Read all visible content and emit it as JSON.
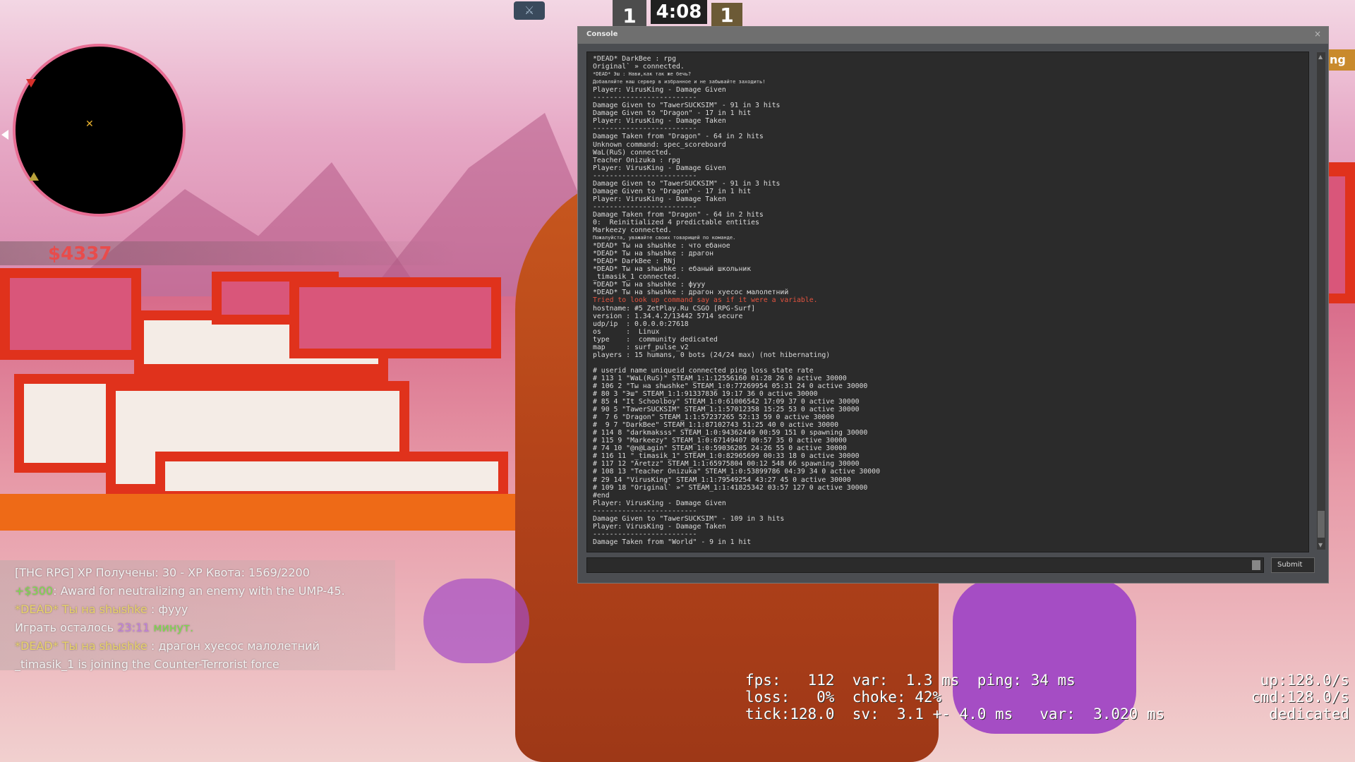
{
  "hud": {
    "money": "$4337",
    "timer": "4:08",
    "score_ct": "1",
    "score_t": "1",
    "right_edge_text": "ng",
    "radar": {
      "map_marker": "✕"
    }
  },
  "chat": [
    {
      "text": "[THC RPG] XP Получены: 30 - XP Квота: 1569/2200",
      "color": "#f2f2f2"
    },
    {
      "parts": [
        {
          "text": "+$300",
          "color": "#7cdc4c"
        },
        {
          "text": ": Award for neutralizing an enemy with the UMP-45.",
          "color": "#f2f2f2"
        }
      ]
    },
    {
      "parts": [
        {
          "text": "*DEAD* Ты на shыshke",
          "color": "#e8d36a"
        },
        {
          "text": " : фууу",
          "color": "#f2f2f2"
        }
      ]
    },
    {
      "parts": [
        {
          "text": "Играть осталось ",
          "color": "#f2f2f2"
        },
        {
          "text": "23:11",
          "color": "#c080e0"
        },
        {
          "text": " минут.",
          "color": "#7cdc4c"
        }
      ]
    },
    {
      "parts": [
        {
          "text": "*DEAD* Ты на shыshke",
          "color": "#e8d36a"
        },
        {
          "text": " : драгон хуесос малолетний",
          "color": "#f2f2f2"
        }
      ]
    },
    {
      "text": "_timasik_1 is joining the Counter-Terrorist force",
      "color": "#f2f2f2"
    }
  ],
  "netgraph": {
    "fps_line": "fps:   112  var:  1.3 ms  ping: 34 ms",
    "loss_line": "loss:   0%  choke: 42%",
    "tick_line": "tick:128.0  sv:  3.1 +- 4.0 ms   var:  3.020 ms",
    "up": "up:128.0/s",
    "cmd": "cmd:128.0/s",
    "server_type": "dedicated"
  },
  "console": {
    "title": "Console",
    "close": "×",
    "submit_label": "Submit",
    "lines": [
      {
        "t": "*DEAD* DarkBee : rpg"
      },
      {
        "t": "Original` » connected."
      },
      {
        "t": "*DEAD* Эш : Нави,как так же бечь?",
        "s": true
      },
      {
        "t": "Добавляйте наш сервер в избранное и не забывайте заходить!",
        "s": true
      },
      {
        "t": "Player: VirusKing - Damage Given"
      },
      {
        "t": "-------------------------"
      },
      {
        "t": "Damage Given to \"TawerSUCKSIM\" - 91 in 3 hits"
      },
      {
        "t": "Damage Given to \"Dragon\" - 17 in 1 hit"
      },
      {
        "t": "Player: VirusKing - Damage Taken"
      },
      {
        "t": "-------------------------"
      },
      {
        "t": "Damage Taken from \"Dragon\" - 64 in 2 hits"
      },
      {
        "t": "Unknown command: spec_scoreboard"
      },
      {
        "t": "WaL(RuS) connected."
      },
      {
        "t": "Teacher Onizuka : rpg"
      },
      {
        "t": "Player: VirusKing - Damage Given"
      },
      {
        "t": "-------------------------"
      },
      {
        "t": "Damage Given to \"TawerSUCKSIM\" - 91 in 3 hits"
      },
      {
        "t": "Damage Given to \"Dragon\" - 17 in 1 hit"
      },
      {
        "t": "Player: VirusKing - Damage Taken"
      },
      {
        "t": "-------------------------"
      },
      {
        "t": "Damage Taken from \"Dragon\" - 64 in 2 hits"
      },
      {
        "t": "0:  Reinitialized 4 predictable entities"
      },
      {
        "t": "Markeezy connected."
      },
      {
        "t": "Пожалуйста, уважайте своих товарищей по команде.",
        "s": true
      },
      {
        "t": "*DEAD* Ты на shыshke : что ебаное"
      },
      {
        "t": "*DEAD* Ты на shыshke : драгон"
      },
      {
        "t": "*DEAD* DarkBee : RNj"
      },
      {
        "t": "*DEAD* Ты на shыshke : ебаный школьник"
      },
      {
        "t": "_timasik_1 connected."
      },
      {
        "t": "*DEAD* Ты на shыshke : фууу"
      },
      {
        "t": "*DEAD* Ты на shыshke : драгон хуесос малолетний"
      },
      {
        "t": "Tried to look up command say as if it were a variable.",
        "err": true
      },
      {
        "t": "hostname: #5 ZetPlay.Ru CSGO [RPG-Surf]"
      },
      {
        "t": "version : 1.34.4.2/13442 5714 secure"
      },
      {
        "t": "udp/ip  : 0.0.0.0:27618"
      },
      {
        "t": "os      :  Linux"
      },
      {
        "t": "type    :  community dedicated"
      },
      {
        "t": "map     : surf_pulse_v2"
      },
      {
        "t": "players : 15 humans, 0 bots (24/24 max) (not hibernating)"
      },
      {
        "t": ""
      },
      {
        "t": "# userid name uniqueid connected ping loss state rate"
      },
      {
        "t": "# 113 1 \"WaL(RuS)\" STEAM_1:1:12556160 01:28 26 0 active 30000"
      },
      {
        "t": "# 106 2 \"Ты на shыshke\" STEAM_1:0:77269954 05:31 24 0 active 30000"
      },
      {
        "t": "# 80 3 \"Эш\" STEAM_1:1:91337836 19:17 36 0 active 30000"
      },
      {
        "t": "# 85 4 \"It Schoolboy\" STEAM_1:0:61006542 17:09 37 0 active 30000"
      },
      {
        "t": "# 90 5 \"TawerSUCKSIM\" STEAM_1:1:57012358 15:25 53 0 active 30000"
      },
      {
        "t": "#  7 6 \"Dragon\" STEAM_1:1:57237265 52:13 59 0 active 30000"
      },
      {
        "t": "#  9 7 \"DarkBee\" STEAM_1:1:87102743 51:25 40 0 active 30000"
      },
      {
        "t": "# 114 8 \"darkmaksss\" STEAM_1:0:94362449 00:59 151 0 spawning 30000"
      },
      {
        "t": "# 115 9 \"Markeezy\" STEAM_1:0:67149407 00:57 35 0 active 30000"
      },
      {
        "t": "# 74 10 \"@n@Lagin\" STEAM_1:0:59036205 24:26 55 0 active 30000"
      },
      {
        "t": "# 116 11 \"_timasik_1\" STEAM_1:0:82965699 00:33 18 0 active 30000"
      },
      {
        "t": "# 117 12 \"Aretzz\" STEAM_1:1:65975804 00:12 548 66 spawning 30000"
      },
      {
        "t": "# 108 13 \"Teacher Onizuka\" STEAM_1:0:53899786 04:39 34 0 active 30000"
      },
      {
        "t": "# 29 14 \"VirusKing\" STEAM_1:1:79549254 43:27 45 0 active 30000"
      },
      {
        "t": "# 109 18 \"Original` »\" STEAM_1:1:41825342 03:57 127 0 active 30000"
      },
      {
        "t": "#end"
      },
      {
        "t": "Player: VirusKing - Damage Given"
      },
      {
        "t": "-------------------------"
      },
      {
        "t": "Damage Given to \"TawerSUCKSIM\" - 109 in 3 hits"
      },
      {
        "t": "Player: VirusKing - Damage Taken"
      },
      {
        "t": "-------------------------"
      },
      {
        "t": "Damage Taken from \"World\" - 9 in 1 hit"
      }
    ]
  }
}
